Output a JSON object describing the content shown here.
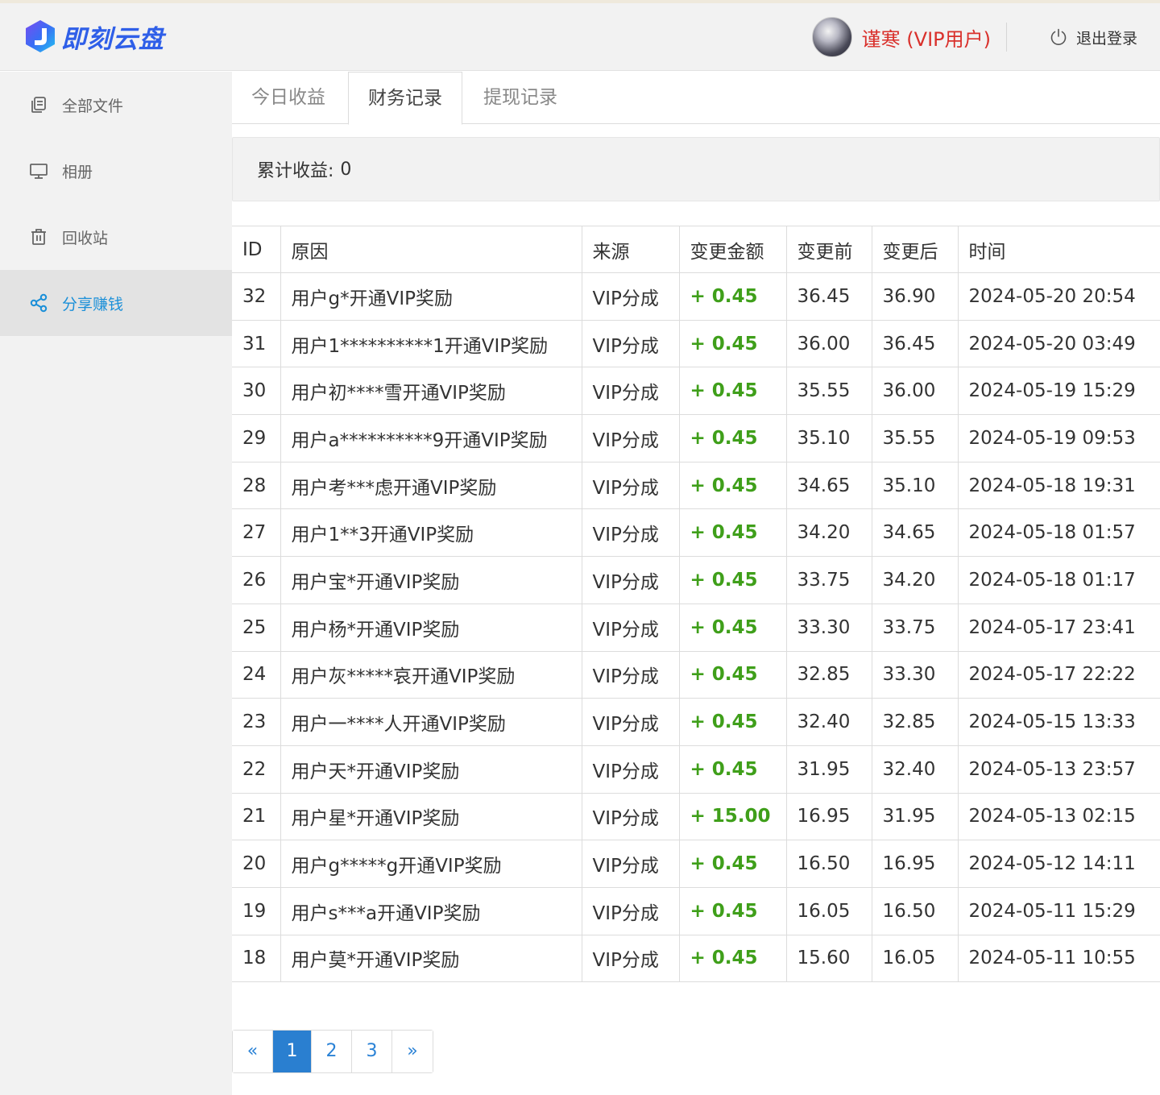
{
  "header": {
    "logo_text": "即刻云盘",
    "username": "谨寒 (VIP用户)",
    "logout_label": "退出登录"
  },
  "sidebar": {
    "items": [
      {
        "label": "全部文件",
        "icon": "copy-icon"
      },
      {
        "label": "相册",
        "icon": "monitor-icon"
      },
      {
        "label": "回收站",
        "icon": "trash-icon"
      },
      {
        "label": "分享赚钱",
        "icon": "share-icon",
        "active": true
      }
    ]
  },
  "tabs": [
    {
      "label": "今日收益"
    },
    {
      "label": "财务记录",
      "active": true
    },
    {
      "label": "提现记录"
    }
  ],
  "summary": {
    "label": "累计收益:",
    "value": "0"
  },
  "table": {
    "headers": [
      "ID",
      "原因",
      "来源",
      "变更金额",
      "变更前",
      "变更后",
      "时间"
    ],
    "rows": [
      [
        "32",
        "用户g*开通VIP奖励",
        "VIP分成",
        "+ 0.45",
        "36.45",
        "36.90",
        "2024-05-20 20:54"
      ],
      [
        "31",
        "用户1**********1开通VIP奖励",
        "VIP分成",
        "+ 0.45",
        "36.00",
        "36.45",
        "2024-05-20 03:49"
      ],
      [
        "30",
        "用户初****雪开通VIP奖励",
        "VIP分成",
        "+ 0.45",
        "35.55",
        "36.00",
        "2024-05-19 15:29"
      ],
      [
        "29",
        "用户a**********9开通VIP奖励",
        "VIP分成",
        "+ 0.45",
        "35.10",
        "35.55",
        "2024-05-19 09:53"
      ],
      [
        "28",
        "用户考***虑开通VIP奖励",
        "VIP分成",
        "+ 0.45",
        "34.65",
        "35.10",
        "2024-05-18 19:31"
      ],
      [
        "27",
        "用户1**3开通VIP奖励",
        "VIP分成",
        "+ 0.45",
        "34.20",
        "34.65",
        "2024-05-18 01:57"
      ],
      [
        "26",
        "用户宝*开通VIP奖励",
        "VIP分成",
        "+ 0.45",
        "33.75",
        "34.20",
        "2024-05-18 01:17"
      ],
      [
        "25",
        "用户杨*开通VIP奖励",
        "VIP分成",
        "+ 0.45",
        "33.30",
        "33.75",
        "2024-05-17 23:41"
      ],
      [
        "24",
        "用户灰*****哀开通VIP奖励",
        "VIP分成",
        "+ 0.45",
        "32.85",
        "33.30",
        "2024-05-17 22:22"
      ],
      [
        "23",
        "用户一****人开通VIP奖励",
        "VIP分成",
        "+ 0.45",
        "32.40",
        "32.85",
        "2024-05-15 13:33"
      ],
      [
        "22",
        "用户天*开通VIP奖励",
        "VIP分成",
        "+ 0.45",
        "31.95",
        "32.40",
        "2024-05-13 23:57"
      ],
      [
        "21",
        "用户星*开通VIP奖励",
        "VIP分成",
        "+ 15.00",
        "16.95",
        "31.95",
        "2024-05-13 02:15"
      ],
      [
        "20",
        "用户g*****g开通VIP奖励",
        "VIP分成",
        "+ 0.45",
        "16.50",
        "16.95",
        "2024-05-12 14:11"
      ],
      [
        "19",
        "用户s***a开通VIP奖励",
        "VIP分成",
        "+ 0.45",
        "16.05",
        "16.50",
        "2024-05-11 15:29"
      ],
      [
        "18",
        "用户莫*开通VIP奖励",
        "VIP分成",
        "+ 0.45",
        "15.60",
        "16.05",
        "2024-05-11 10:55"
      ]
    ]
  },
  "pagination": {
    "prev": "«",
    "pages": [
      "1",
      "2",
      "3"
    ],
    "current": "1",
    "next": "»"
  },
  "colors": {
    "accent": "#1a8fd8",
    "username": "#d9302b",
    "amount": "#3f9f1a",
    "page_active": "#2a7fd0"
  }
}
